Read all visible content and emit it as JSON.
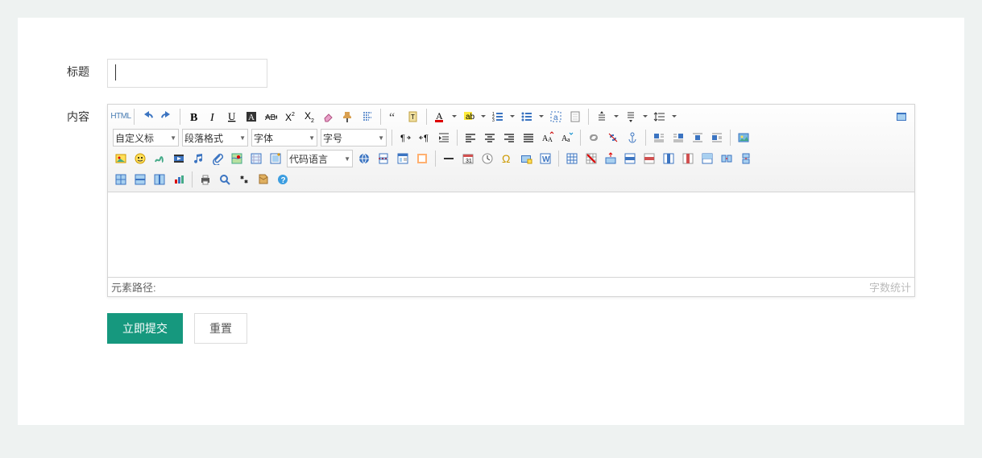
{
  "labels": {
    "title": "标题",
    "content": "内容"
  },
  "toolbar": {
    "html": "HTML",
    "custom_title": "自定义标",
    "paragraph": "段落格式",
    "font_family": "字体",
    "font_size": "字号",
    "code_lang": "代码语言"
  },
  "status": {
    "path": "元素路径:",
    "wordcount": "字数统计"
  },
  "buttons": {
    "submit": "立即提交",
    "reset": "重置"
  }
}
